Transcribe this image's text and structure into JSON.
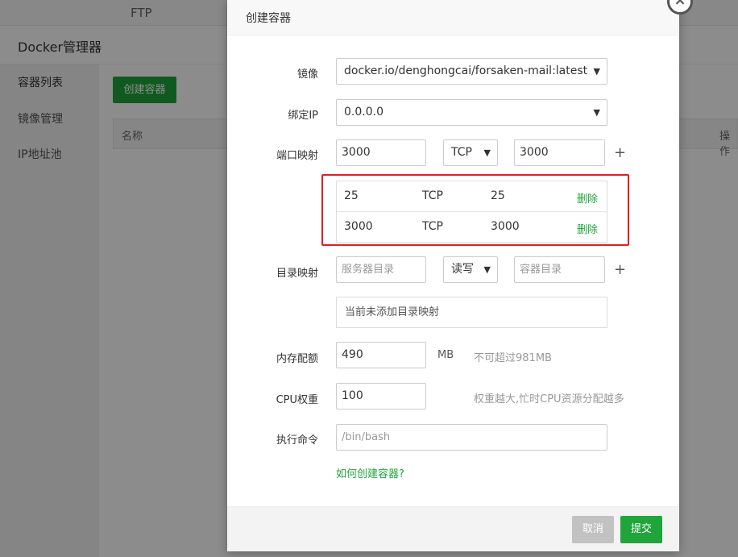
{
  "background": {
    "top_tab": "FTP",
    "header_title": "Docker管理器",
    "sidebar": [
      {
        "label": "容器列表"
      },
      {
        "label": "镜像管理"
      },
      {
        "label": "IP地址池"
      }
    ],
    "create_button": "创建容器",
    "table_headers": {
      "name": "名称",
      "ops": "操作"
    }
  },
  "modal": {
    "title": "创建容器",
    "image": {
      "label": "镜像",
      "value": "docker.io/denghongcai/forsaken-mail:latest"
    },
    "bind_ip": {
      "label": "绑定IP",
      "value": "0.0.0.0"
    },
    "port_map": {
      "label": "端口映射",
      "host_port": "3000",
      "protocol": "TCP",
      "container_port": "3000",
      "plus": "+",
      "rows": [
        {
          "host": "25",
          "protocol": "TCP",
          "container": "25",
          "action": "删除"
        },
        {
          "host": "3000",
          "protocol": "TCP",
          "container": "3000",
          "action": "删除"
        }
      ]
    },
    "dir_map": {
      "label": "目录映射",
      "host_placeholder": "服务器目录",
      "mode": "读写",
      "container_placeholder": "容器目录",
      "plus": "+",
      "empty_text": "当前未添加目录映射"
    },
    "memory": {
      "label": "内存配额",
      "value": "490",
      "unit": "MB",
      "hint": "不可超过981MB"
    },
    "cpu": {
      "label": "CPU权重",
      "value": "100",
      "hint": "权重越大,忙时CPU资源分配越多"
    },
    "command": {
      "label": "执行命令",
      "placeholder": "/bin/bash"
    },
    "help_link": "如何创建容器?",
    "cancel": "取消",
    "submit": "提交"
  },
  "colors": {
    "accent": "#20a53a",
    "highlight": "#e02020"
  }
}
